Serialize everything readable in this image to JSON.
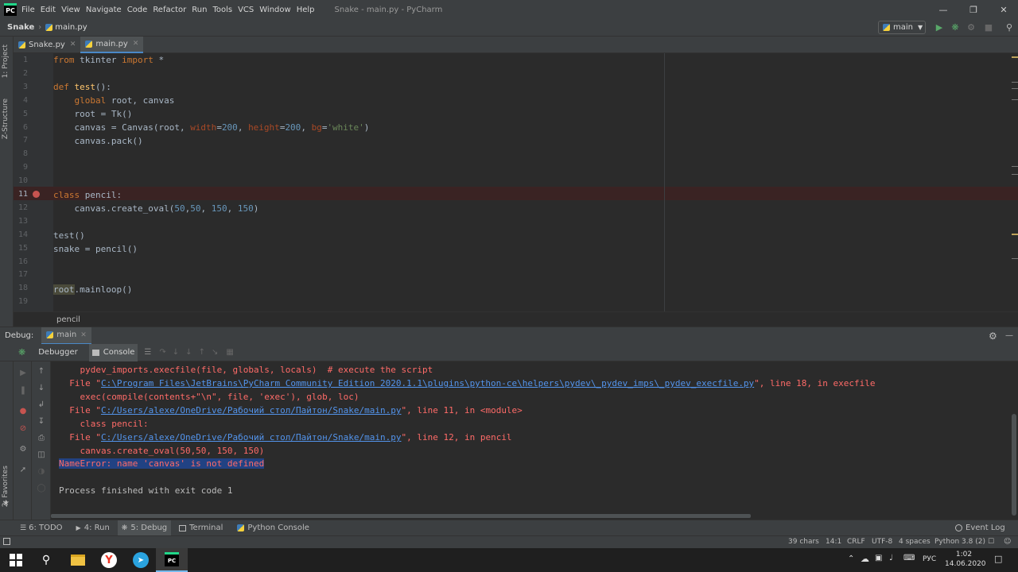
{
  "menubar": {
    "logo": "PC",
    "items": [
      "File",
      "Edit",
      "View",
      "Navigate",
      "Code",
      "Refactor",
      "Run",
      "Tools",
      "VCS",
      "Window",
      "Help"
    ],
    "window_title": "Snake - main.py - PyCharm"
  },
  "navbar": {
    "project": "Snake",
    "file": "main.py",
    "run_config": "main"
  },
  "tabs": [
    {
      "label": "Snake.py",
      "active": false
    },
    {
      "label": "main.py",
      "active": true
    }
  ],
  "left_strip": {
    "project": "1: Project",
    "structure": "Z-Structure",
    "favorites": "2: Favorites"
  },
  "editor": {
    "line_numbers": [
      "1",
      "2",
      "3",
      "4",
      "5",
      "6",
      "7",
      "8",
      "9",
      "10",
      "11",
      "12",
      "13",
      "14",
      "15",
      "16",
      "17",
      "18",
      "19"
    ],
    "breakpoint_line": 11,
    "breadcrumb": "pencil"
  },
  "debug": {
    "label": "Debug:",
    "run_tab": "main",
    "tab_debugger": "Debugger",
    "tab_console": "Console"
  },
  "console": {
    "line1": "    pydev_imports.execfile(file, globals, locals)  # execute the script",
    "line2_pre": "  File \"",
    "line2_link": "C:\\Program Files\\JetBrains\\PyCharm Community Edition 2020.1.1\\plugins\\python-ce\\helpers\\pydev\\_pydev_imps\\_pydev_execfile.py",
    "line2_post": "\", line 18, in execfile",
    "line3": "    exec(compile(contents+\"\\n\", file, 'exec'), glob, loc)",
    "line4_pre": "  File \"",
    "line4_link": "C:/Users/alexe/OneDrive/Рабочий стол/Пайтон/Snake/main.py",
    "line4_post": "\", line 11, in <module>",
    "line5": "    class pencil:",
    "line6_pre": "  File \"",
    "line6_link": "C:/Users/alexe/OneDrive/Рабочий стол/Пайтон/Snake/main.py",
    "line6_post": "\", line 12, in pencil",
    "line7": "    canvas.create_oval(50,50, 150, 150)",
    "line8": "NameError: name 'canvas' is not defined",
    "line9": "Process finished with exit code 1"
  },
  "bottom_tabs": {
    "todo": "6: TODO",
    "run": "4: Run",
    "debug": "5: Debug",
    "terminal": "Terminal",
    "python_console": "Python Console",
    "event_log": "Event Log"
  },
  "status": {
    "chars": "39 chars",
    "position": "14:1",
    "line_sep": "CRLF",
    "encoding": "UTF-8",
    "indent": "4 spaces",
    "interpreter": "Python 3.8 (2)"
  },
  "taskbar": {
    "lang": "РУС",
    "time": "1:02",
    "date": "14.06.2020"
  },
  "colors": {
    "bg": "#2b2b2b",
    "chrome": "#3c3f41",
    "keyword": "#cc7832",
    "error": "#ff6b68",
    "link": "#5394ec",
    "selection": "#214283"
  }
}
